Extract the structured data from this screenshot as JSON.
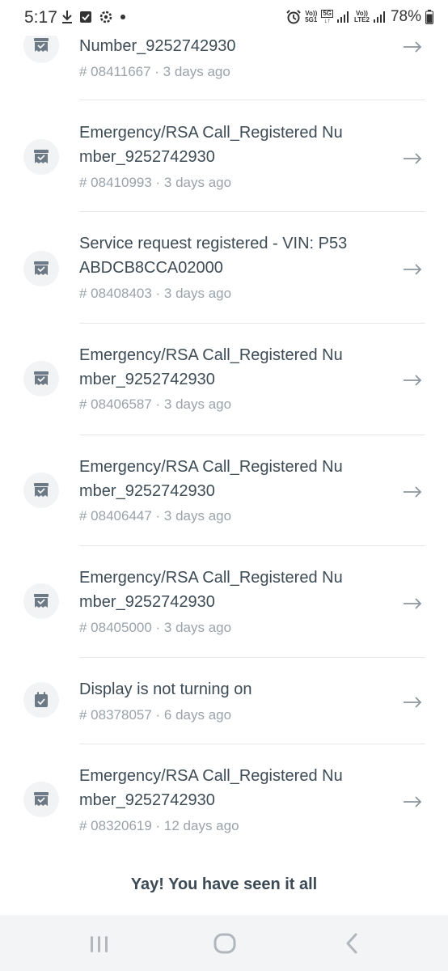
{
  "status": {
    "time": "5:17",
    "battery": "78%",
    "volte1_top": "Vo))",
    "volte1_bottom": "5G1",
    "net_5g": "5G",
    "volte2_top": "Vo))",
    "volte2_bottom": "LTE2"
  },
  "tickets": [
    {
      "title": "Number_9252742930",
      "meta": "# 08411667 · 3 days ago",
      "icon": "receipt-check-icon"
    },
    {
      "title": "Emergency/RSA Call_Registered Number_9252742930",
      "meta": "# 08410993 · 3 days ago",
      "icon": "receipt-check-icon"
    },
    {
      "title": "Service request registered - VIN: P53ABDCB8CCA02000",
      "meta": "# 08408403 · 3 days ago",
      "icon": "receipt-check-icon"
    },
    {
      "title": "Emergency/RSA Call_Registered Number_9252742930",
      "meta": "# 08406587 · 3 days ago",
      "icon": "receipt-check-icon"
    },
    {
      "title": "Emergency/RSA Call_Registered Number_9252742930",
      "meta": "# 08406447 · 3 days ago",
      "icon": "receipt-check-icon"
    },
    {
      "title": "Emergency/RSA Call_Registered Number_9252742930",
      "meta": "# 08405000 · 3 days ago",
      "icon": "receipt-check-icon"
    },
    {
      "title": "Display is not turning on",
      "meta": "# 08378057 · 6 days ago",
      "icon": "calendar-check-icon"
    },
    {
      "title": "Emergency/RSA Call_Registered Number_9252742930",
      "meta": "# 08320619 · 12 days ago",
      "icon": "receipt-check-icon"
    }
  ],
  "footer": {
    "message": "Yay! You have seen it all"
  },
  "colors": {
    "icon_bg": "#f1f3f5",
    "icon_fg": "#6d7a85",
    "text": "#3d4b55",
    "meta": "#9aa3aa"
  }
}
